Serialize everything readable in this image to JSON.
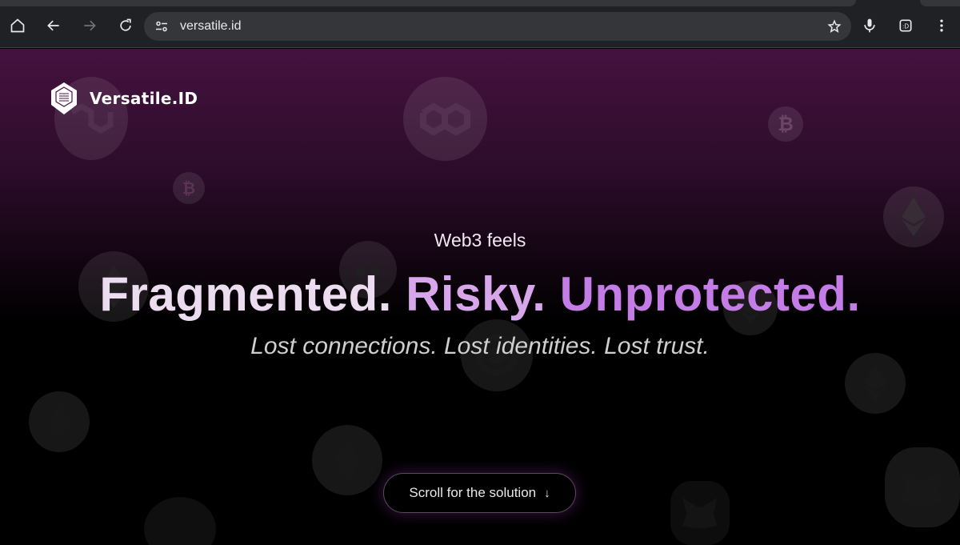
{
  "browser": {
    "url": "versatile.id",
    "extension_label": ":D",
    "icons": [
      "home-icon",
      "back-icon",
      "forward-icon",
      "reload-icon",
      "site-info-icon",
      "bookmark-star-icon",
      "mic-icon",
      "extension-icon",
      "menu-icon"
    ]
  },
  "brand": {
    "name": "Versatile.ID"
  },
  "hero": {
    "kicker": "Web3 feels",
    "headline_1": "Fragmented.",
    "headline_2": "Risky.",
    "headline_3": "Unprotected.",
    "subline": "Lost connections. Lost identities. Lost trust."
  },
  "cta": {
    "label": "Scroll for the solution",
    "arrow": "↓"
  },
  "colors": {
    "headline_1": "#ecdcef",
    "headline_2": "#d8a6ea",
    "headline_3": "#c47ce6",
    "page_top": "#45123f",
    "chrome_bg": "#202124"
  }
}
